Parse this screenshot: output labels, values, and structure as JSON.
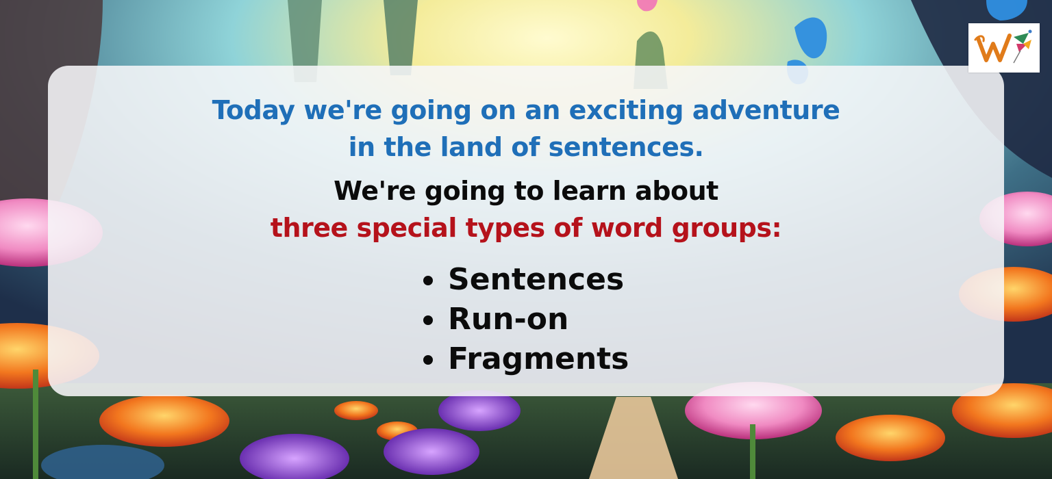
{
  "colors": {
    "intro_text": "#1f6fb8",
    "lead_text": "#0b0b0b",
    "highlight_text": "#b5121b",
    "logo_letter": "#e07b1a"
  },
  "card": {
    "intro_line_1": "Today we're going on an exciting adventure",
    "intro_line_2": "in the land of sentences.",
    "lead_line_1": "We're going to learn about",
    "lead_line_2": "three special types of word groups:",
    "topics": [
      "Sentences",
      "Run-on",
      "Fragments"
    ]
  },
  "logo": {
    "icon": "w-kite-logo-icon"
  },
  "background": {
    "icon": "fantasy-flower-garden-scene"
  }
}
